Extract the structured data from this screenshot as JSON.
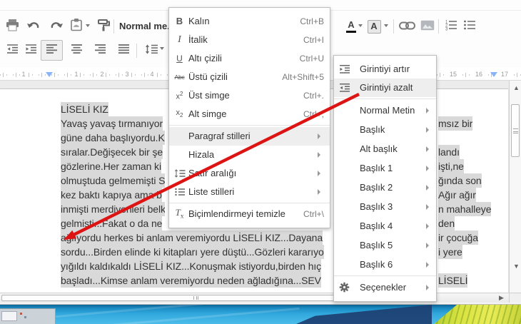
{
  "colors": {
    "selection_highlight": "#d9d9d9",
    "ruler_marker": "#8ab4f8",
    "annotation_arrow": "#dd1414"
  },
  "toolbar": {
    "style_button_label": "Normal me..."
  },
  "ruler": {
    "left_numbers": [
      "1",
      "1",
      "2",
      "3",
      "4"
    ],
    "right_numbers": [
      "15",
      "16",
      "17"
    ]
  },
  "format_menu": {
    "items": [
      {
        "icon": "bold",
        "label": "Kalın",
        "shortcut": "Ctrl+B"
      },
      {
        "icon": "italic",
        "label": "İtalik",
        "shortcut": "Ctrl+I"
      },
      {
        "icon": "underline",
        "label": "Altı çizili",
        "shortcut": "Ctrl+U"
      },
      {
        "icon": "strikethrough",
        "label": "Üstü çizili",
        "shortcut": "Alt+Shift+5"
      },
      {
        "icon": "superscript",
        "label": "Üst simge",
        "shortcut": "Ctrl+."
      },
      {
        "icon": "subscript",
        "label": "Alt simge",
        "shortcut": "Ctrl+,"
      },
      {
        "type": "separator"
      },
      {
        "label": "Paragraf stilleri",
        "arrow": true,
        "highlighted": true
      },
      {
        "label": "Hizala",
        "arrow": true
      },
      {
        "icon": "line-spacing",
        "label": "Satır aralığı",
        "arrow": true
      },
      {
        "icon": "list-styles",
        "label": "Liste stilleri",
        "arrow": true
      },
      {
        "type": "separator"
      },
      {
        "icon": "clear-formatting",
        "label": "Biçimlendirmeyi temizle",
        "shortcut": "Ctrl+\\"
      }
    ]
  },
  "styles_submenu": {
    "items": [
      {
        "icon": "indent-more",
        "label": "Girintiyi artır"
      },
      {
        "icon": "indent-less",
        "label": "Girintiyi azalt",
        "highlighted": true
      },
      {
        "type": "separator"
      },
      {
        "label": "Normal Metin",
        "arrow": true
      },
      {
        "label": "Başlık",
        "arrow": true
      },
      {
        "label": "Alt başlık",
        "arrow": true
      },
      {
        "label": "Başlık 1",
        "arrow": true
      },
      {
        "label": "Başlık 2",
        "arrow": true
      },
      {
        "label": "Başlık 3",
        "arrow": true
      },
      {
        "label": "Başlık 4",
        "arrow": true
      },
      {
        "label": "Başlık 5",
        "arrow": true
      },
      {
        "label": "Başlık 6",
        "arrow": true
      },
      {
        "type": "separator"
      },
      {
        "icon": "gear",
        "label": "Seçenekler",
        "arrow": true
      }
    ]
  },
  "document": {
    "lines": [
      {
        "left": "LİSELİ KIZ",
        "right": ""
      },
      {
        "left": "Yavaş yavaş tırmanıyor",
        "right": "msız bir"
      },
      {
        "left": "güne daha başlıyordu.K",
        "right": ""
      },
      {
        "left": "sıralar.Değişecek bir şe",
        "right": "landı"
      },
      {
        "left": "gözlerine.Her zaman ki",
        "right": "işti,ne"
      },
      {
        "left": "olmuştuda gelmemişti S",
        "right": "ğında son"
      },
      {
        "left": "kez baktı kapıya ama b",
        "right": "Ağır ağır"
      },
      {
        "left": "inmişti merdivenleri belk",
        "right": "n mahalleye"
      },
      {
        "left": "gelmişti...Fakat o da ne",
        "right": "den"
      },
      {
        "left": "ağlıyordu herkes bi anlam veremiyordu LİSELİ KIZ...Dayana",
        "right": "ir çocuğa"
      },
      {
        "left": "sordu...Birden elinde ki kitapları yere düştü...Gözleri kararıyo",
        "right": "i yere"
      },
      {
        "left": "yığıldı kaldıkaldı LİSELİ KIZ...Konuşmak istiyordu,birden hıç",
        "right": ""
      },
      {
        "left": "başladı...Kimse anlam veremiyordu neden ağladığına...SEV",
        "right": "LİSELİ"
      }
    ]
  }
}
